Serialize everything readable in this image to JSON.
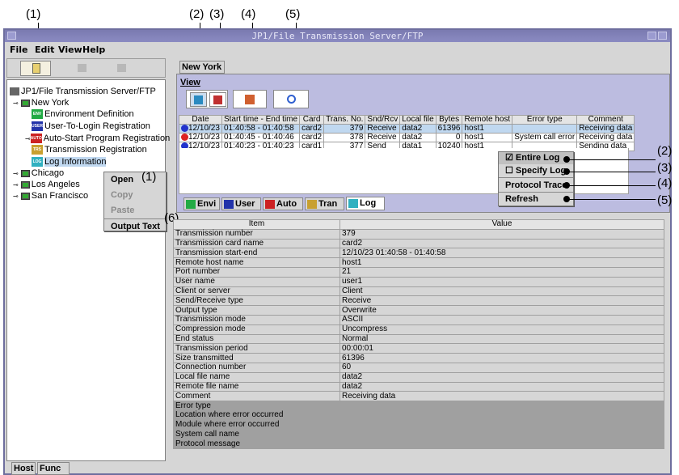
{
  "callouts": {
    "top": [
      "(1)",
      "(2)",
      "(3)",
      "(4)",
      "(5)"
    ],
    "right": [
      "(2)",
      "(3)",
      "(4)",
      "(5)"
    ],
    "menu_one": "(1)",
    "menu_six": "(6)"
  },
  "window": {
    "title": "JP1/File Transmission Server/FTP"
  },
  "menubar": {
    "file": "File",
    "edit": "Edit",
    "view": "View",
    "help": "Help"
  },
  "tree": {
    "root": "JP1/File Transmission Server/FTP",
    "host": "New York",
    "items": [
      {
        "icon": "environment-definition-icon",
        "label": "Environment Definition",
        "color": "#22aa44",
        "tag": "ENV"
      },
      {
        "icon": "user-icon",
        "label": "User-To-Login Registration",
        "color": "#2233aa",
        "tag": "USER"
      },
      {
        "icon": "auto-icon",
        "label": "Auto-Start Program Registration",
        "color": "#cc2222",
        "tag": "AUTO"
      },
      {
        "icon": "transmission-icon",
        "label": "Transmission Registration",
        "color": "#c8a030",
        "tag": "TRS"
      },
      {
        "icon": "log-icon",
        "label": "Log Information",
        "color": "#30b0c0",
        "tag": "LOG"
      }
    ],
    "others": [
      "Chicago",
      "Los Angeles",
      "San Francisco"
    ]
  },
  "context_menu": {
    "items": [
      "Open",
      "Copy",
      "Paste",
      "Output Text"
    ]
  },
  "bottom_tabs": [
    "Host",
    "Func"
  ],
  "right_tab": "New York",
  "view_label": "View",
  "log_table": {
    "headers": [
      "Date",
      "Start time - End time",
      "Card",
      "Trans. No.",
      "Snd/Rcv",
      "Local file",
      "Bytes",
      "Remote host",
      "Error type",
      "Comment"
    ],
    "rows": [
      {
        "status": "#2233cc",
        "date": "12/10/23",
        "time": "01:40:58 - 01:40:58",
        "card": "card2",
        "no": "379",
        "sr": "Receive",
        "file": "data2",
        "bytes": "61396",
        "host": "host1",
        "err": "",
        "comment": "Receiving data"
      },
      {
        "status": "#dd2222",
        "date": "12/10/23",
        "time": "01:40:45 - 01:40:46",
        "card": "card2",
        "no": "378",
        "sr": "Receive",
        "file": "data2",
        "bytes": "0",
        "host": "host1",
        "err": "System call error",
        "comment": "Receiving data"
      },
      {
        "status": "#2233cc",
        "date": "12/10/23",
        "time": "01:40:23 - 01:40:23",
        "card": "card1",
        "no": "377",
        "sr": "Send",
        "file": "data1",
        "bytes": "10240",
        "host": "host1",
        "err": "",
        "comment": "Sending data"
      }
    ]
  },
  "view_menu": {
    "items": [
      "Entire Log",
      "Specify Log",
      "Protocol Trace",
      "Refresh"
    ]
  },
  "func_tabs": [
    "Envi",
    "User",
    "Auto",
    "Tran",
    "Log"
  ],
  "detail": {
    "headers": [
      "Item",
      "Value"
    ],
    "rows": [
      [
        "Transmission number",
        "379"
      ],
      [
        "Transmission card name",
        "card2"
      ],
      [
        "Transmission start-end",
        "12/10/23 01:40:58 - 01:40:58"
      ],
      [
        "Remote host name",
        "host1"
      ],
      [
        "Port number",
        "21"
      ],
      [
        "User name",
        "user1"
      ],
      [
        "Client or server",
        "Client"
      ],
      [
        "Send/Receive type",
        "Receive"
      ],
      [
        "Output type",
        "Overwrite"
      ],
      [
        "Transmission mode",
        "ASCII"
      ],
      [
        "Compression mode",
        "Uncompress"
      ],
      [
        "End status",
        "Normal"
      ],
      [
        "Transmission period",
        "00:00:01"
      ],
      [
        "Size transmitted",
        "61396"
      ],
      [
        "Connection number",
        "60"
      ],
      [
        "Local file name",
        "data2"
      ],
      [
        "Remote file name",
        "data2"
      ],
      [
        "Comment",
        "Receiving data"
      ],
      [
        "Error type",
        ""
      ],
      [
        "Location where error occurred",
        ""
      ],
      [
        "Module where error occurred",
        ""
      ],
      [
        "System call name",
        ""
      ],
      [
        "Protocol message",
        ""
      ]
    ]
  }
}
